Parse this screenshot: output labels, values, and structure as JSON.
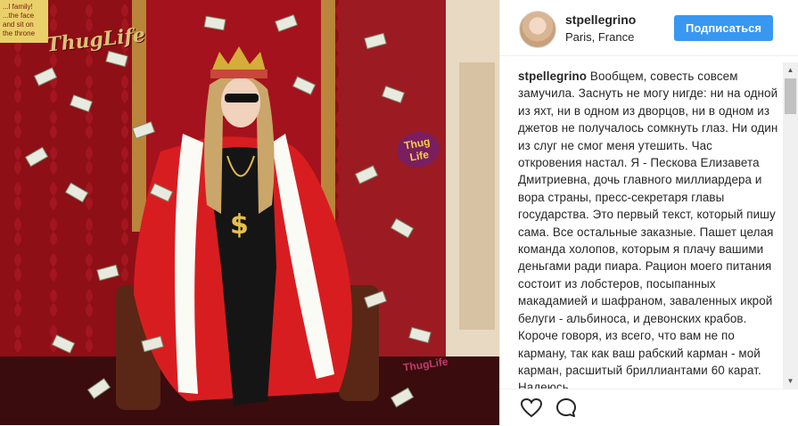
{
  "post": {
    "username": "stpellegrino",
    "location": "Paris, France",
    "follow_label": "Подписаться"
  },
  "photo": {
    "logo_text": "ThugLife",
    "badge_text": "Thug Life",
    "sign_text": "...l family! ...the face and sit on the throne",
    "watermark_text": "ThugLife"
  },
  "caption": {
    "author": "stpellegrino",
    "text": "Вообщем, совесть совсем замучила. Заснуть не могу нигде: ни на одной из яхт, ни в одном из дворцов, ни в одном из джетов не получалось сомкнуть глаз. Ни один из слуг не смог меня утешить. Час откровения настал. Я - Пескова Елизавета Дмитриевна, дочь главного миллиардера и вора страны, пресс-секретаря главы государства. Это первый текст, который пишу сама. Все остальные заказные. Пашет целая команда холопов, которым я плачу вашими деньгами ради пиара. Рацион моего питания состоит из лобстеров, посыпанных макадамией и шафраном, заваленных икрой белуги - альбиноса, и девонских крабов. Короче говоря, из всего, что вам не по карману, так как ваш рабский карман - мой карман, расшитый бриллиантами 60 карат. Надеюсь,"
  },
  "icons": {
    "like": "heart-icon",
    "comment": "comment-icon"
  },
  "colors": {
    "accent": "#3897f0",
    "text": "#262626",
    "photo_red": "#b4121b"
  }
}
